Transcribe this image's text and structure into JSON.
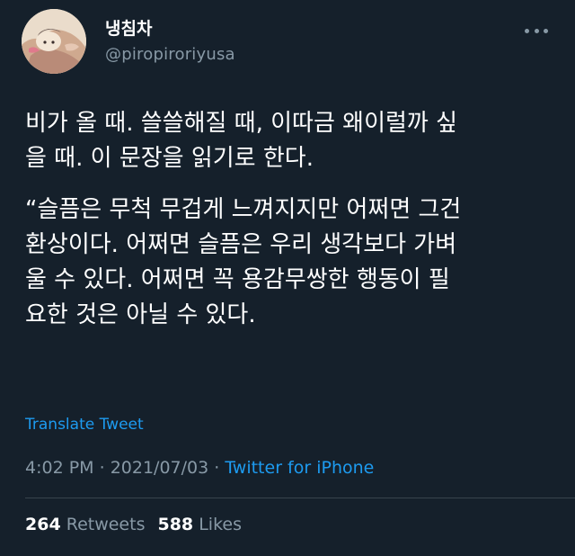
{
  "author": {
    "display_name": "냉침차",
    "handle": "@piropiroriyusa",
    "avatar_icon": "illustrated-avatar-icon"
  },
  "tweet": {
    "paragraphs": [
      "비가 올 때. 쓸쓸해질 때, 이따금 왜이럴까 싶\n을 때. 이 문장을 읽기로 한다.",
      "“슬픔은 무척 무겁게 느껴지지만 어쩌면 그건\n환상이다. 어쩌면 슬픔은 우리 생각보다 가벼\n울 수 있다. 어쩌면 꼭 용감무쌍한 행동이 필\n요한 것은 아닐 수 있다."
    ],
    "translate_label": "Translate Tweet",
    "time": "4:02 PM",
    "date": "2021/07/03",
    "separator": " · ",
    "source": "Twitter for iPhone"
  },
  "stats": {
    "retweets_count": "264",
    "retweets_label": "Retweets",
    "likes_count": "588",
    "likes_label": "Likes"
  },
  "colors": {
    "background": "#15202b",
    "text_primary": "#ffffff",
    "text_secondary": "#8899a6",
    "link": "#1d9bf0",
    "divider": "#38444d"
  }
}
